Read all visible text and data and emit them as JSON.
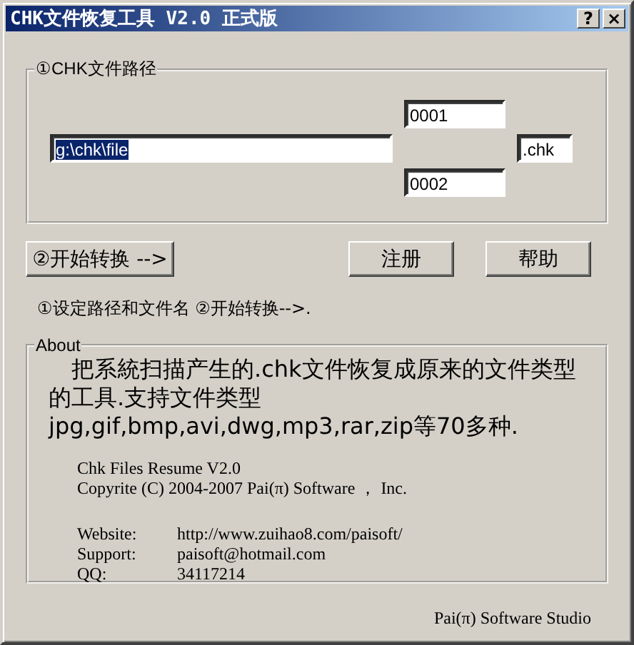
{
  "window": {
    "title": "CHK文件恢复工具 V2.0 正式版",
    "title_buttons": [
      "?",
      "×"
    ]
  },
  "path_group": {
    "legend": "①CHK文件路径",
    "path": "g:\\chk\\file",
    "path_selected": true,
    "start_number": "0001",
    "end_number": "0002",
    "extension": ".chk"
  },
  "buttons": [
    "②开始转换 -->",
    "注册",
    "帮助"
  ],
  "hint": "①设定路径和文件名 ②开始转换-->.",
  "about": {
    "legend": "About",
    "intro": "把系統扫描产生的.chk文件恢复成原来的文件类型的工具.支持文件类型jpg,gif,bmp,avi,dwg,mp3,rar,zip等70多种.",
    "product": "Chk Files Resume V2.0",
    "copyright": "Copyrite (C) 2004-2007  Pai(π)  Software ， Inc.",
    "contacts": [
      {
        "label": "Website:",
        "value": "http://www.zuihao8.com/paisoft/"
      },
      {
        "label": "Support:",
        "value": "paisoft@hotmail.com"
      },
      {
        "label": "QQ:",
        "value": "34117214"
      }
    ]
  },
  "footer": "Pai(π) Software Studio"
}
